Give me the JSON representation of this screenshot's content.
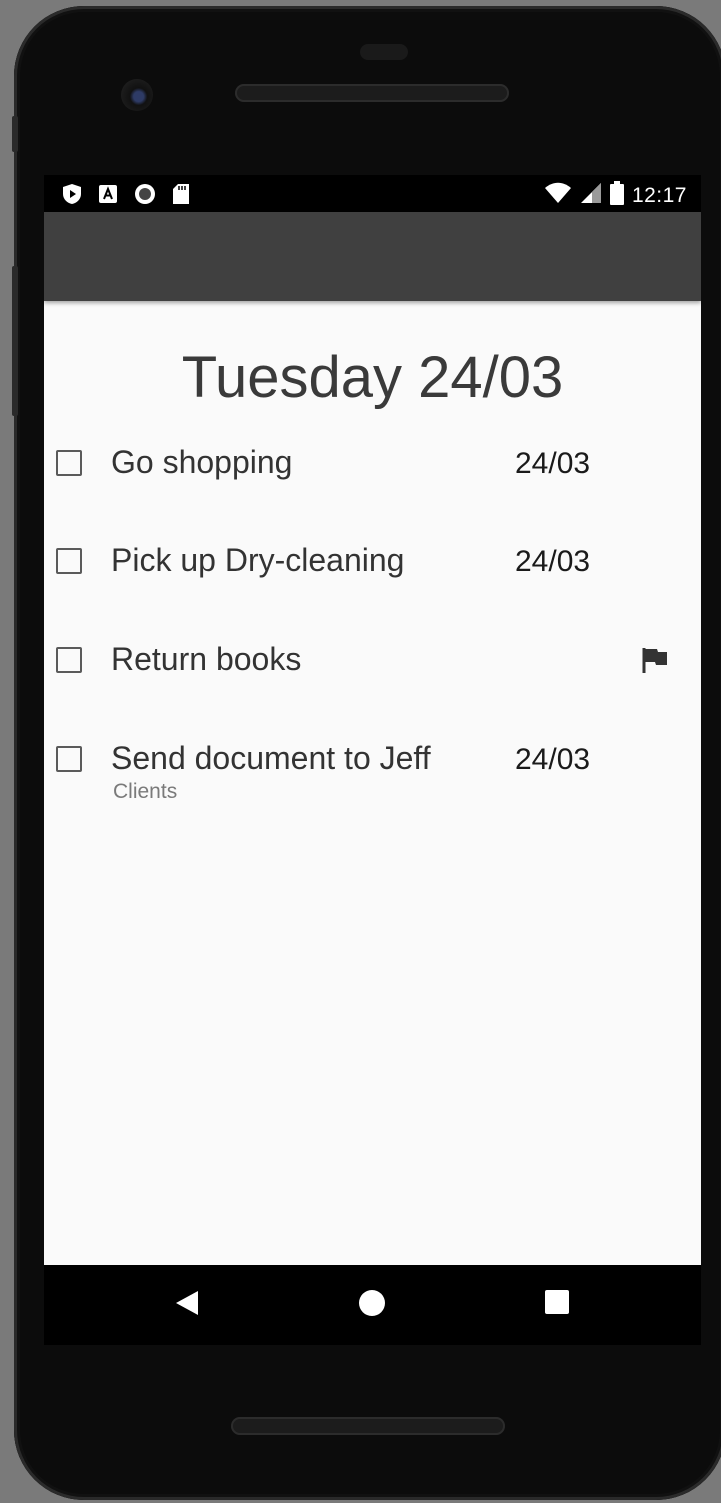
{
  "status_bar": {
    "time": "12:17",
    "left_icons": [
      "play-protect-icon",
      "a-icon",
      "circle-icon",
      "sd-card-icon"
    ],
    "right_icons": [
      "wifi-icon",
      "signal-icon",
      "battery-icon"
    ]
  },
  "app_bar": {
    "color": "#404040"
  },
  "header": {
    "title": "Tuesday 24/03"
  },
  "tasks": [
    {
      "title": "Go shopping",
      "date": "24/03",
      "subtitle": "",
      "flagged": false
    },
    {
      "title": "Pick up Dry-cleaning",
      "date": "24/03",
      "subtitle": "",
      "flagged": false
    },
    {
      "title": "Return books",
      "date": "",
      "subtitle": "",
      "flagged": true
    },
    {
      "title": "Send document to Jeff",
      "date": "24/03",
      "subtitle": "Clients",
      "flagged": false
    }
  ],
  "nav_bar": {
    "buttons": [
      "back-icon",
      "home-icon",
      "recents-icon"
    ]
  }
}
